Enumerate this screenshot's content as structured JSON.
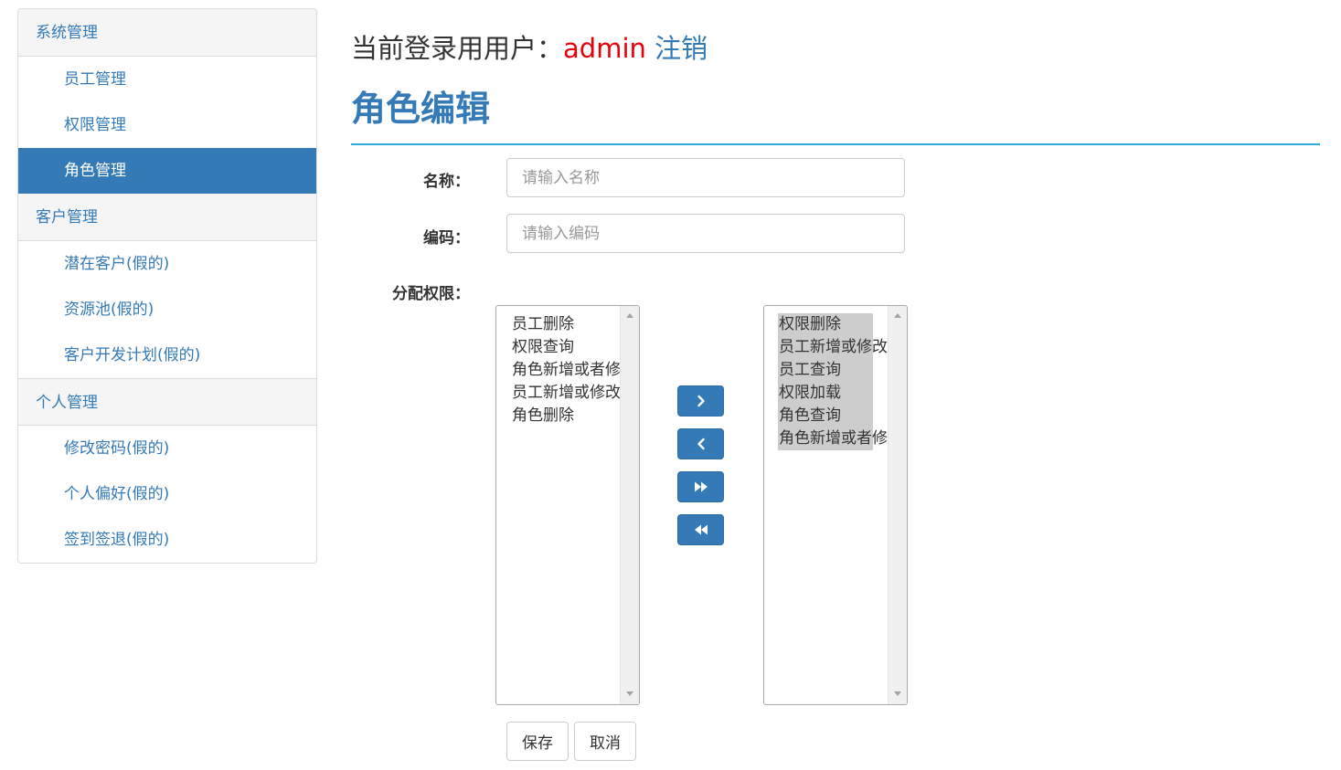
{
  "sidebar": {
    "groups": [
      {
        "title": "系统管理",
        "items": [
          {
            "label": "员工管理",
            "active": false
          },
          {
            "label": "权限管理",
            "active": false
          },
          {
            "label": "角色管理",
            "active": true
          }
        ]
      },
      {
        "title": "客户管理",
        "items": [
          {
            "label": "潜在客户(假的)",
            "active": false
          },
          {
            "label": "资源池(假的)",
            "active": false
          },
          {
            "label": "客户开发计划(假的)",
            "active": false
          }
        ]
      },
      {
        "title": "个人管理",
        "items": [
          {
            "label": "修改密码(假的)",
            "active": false
          },
          {
            "label": "个人偏好(假的)",
            "active": false
          },
          {
            "label": "签到签退(假的)",
            "active": false
          }
        ]
      }
    ]
  },
  "header": {
    "login_prefix": "当前登录用用户：",
    "username": "admin",
    "logout": "注销"
  },
  "page": {
    "title": "角色编辑"
  },
  "form": {
    "name_label": "名称：",
    "name_placeholder": "请输入名称",
    "name_value": "",
    "code_label": "编码：",
    "code_placeholder": "请输入编码",
    "code_value": "",
    "perm_label": "分配权限："
  },
  "permissions": {
    "available": [
      "员工删除",
      "权限查询",
      "角色新增或者修改",
      "员工新增或修改",
      "角色删除"
    ],
    "selected": [
      "权限删除",
      "员工新增或修改",
      "员工查询",
      "权限加载",
      "角色查询",
      "角色新增或者修改"
    ]
  },
  "transfer_buttons": [
    {
      "icon": "chevron-right-icon",
      "name": "move-right-button"
    },
    {
      "icon": "chevron-left-icon",
      "name": "move-left-button"
    },
    {
      "icon": "double-chevron-right-icon",
      "name": "move-all-right-button"
    },
    {
      "icon": "double-chevron-left-icon",
      "name": "move-all-left-button"
    }
  ],
  "actions": {
    "save": "保存",
    "cancel": "取消"
  },
  "colors": {
    "primary": "#337ab7",
    "username": "#e8000b",
    "divider": "#29a8df"
  }
}
